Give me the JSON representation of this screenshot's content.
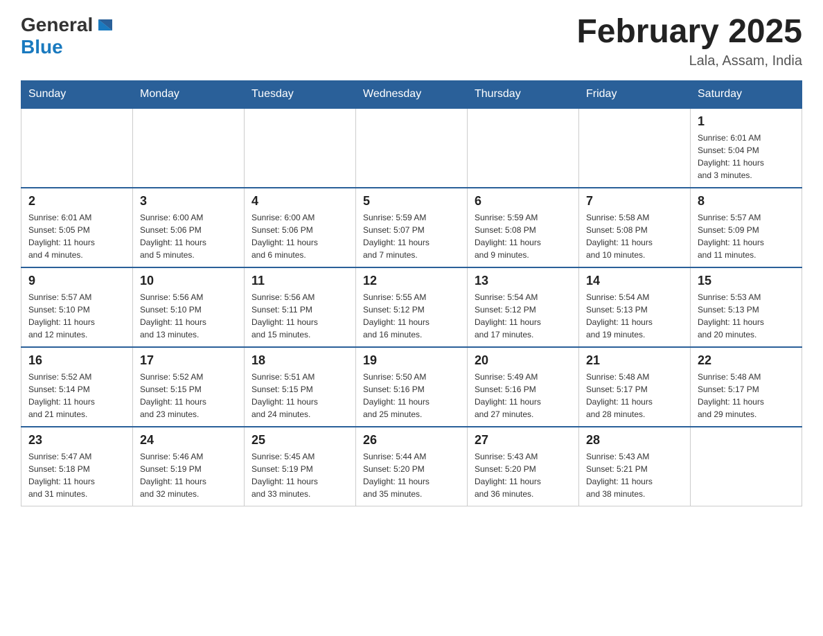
{
  "header": {
    "logo_general": "General",
    "logo_blue": "Blue",
    "month_title": "February 2025",
    "location": "Lala, Assam, India"
  },
  "weekdays": [
    "Sunday",
    "Monday",
    "Tuesday",
    "Wednesday",
    "Thursday",
    "Friday",
    "Saturday"
  ],
  "weeks": [
    [
      {
        "day": "",
        "info": ""
      },
      {
        "day": "",
        "info": ""
      },
      {
        "day": "",
        "info": ""
      },
      {
        "day": "",
        "info": ""
      },
      {
        "day": "",
        "info": ""
      },
      {
        "day": "",
        "info": ""
      },
      {
        "day": "1",
        "info": "Sunrise: 6:01 AM\nSunset: 5:04 PM\nDaylight: 11 hours\nand 3 minutes."
      }
    ],
    [
      {
        "day": "2",
        "info": "Sunrise: 6:01 AM\nSunset: 5:05 PM\nDaylight: 11 hours\nand 4 minutes."
      },
      {
        "day": "3",
        "info": "Sunrise: 6:00 AM\nSunset: 5:06 PM\nDaylight: 11 hours\nand 5 minutes."
      },
      {
        "day": "4",
        "info": "Sunrise: 6:00 AM\nSunset: 5:06 PM\nDaylight: 11 hours\nand 6 minutes."
      },
      {
        "day": "5",
        "info": "Sunrise: 5:59 AM\nSunset: 5:07 PM\nDaylight: 11 hours\nand 7 minutes."
      },
      {
        "day": "6",
        "info": "Sunrise: 5:59 AM\nSunset: 5:08 PM\nDaylight: 11 hours\nand 9 minutes."
      },
      {
        "day": "7",
        "info": "Sunrise: 5:58 AM\nSunset: 5:08 PM\nDaylight: 11 hours\nand 10 minutes."
      },
      {
        "day": "8",
        "info": "Sunrise: 5:57 AM\nSunset: 5:09 PM\nDaylight: 11 hours\nand 11 minutes."
      }
    ],
    [
      {
        "day": "9",
        "info": "Sunrise: 5:57 AM\nSunset: 5:10 PM\nDaylight: 11 hours\nand 12 minutes."
      },
      {
        "day": "10",
        "info": "Sunrise: 5:56 AM\nSunset: 5:10 PM\nDaylight: 11 hours\nand 13 minutes."
      },
      {
        "day": "11",
        "info": "Sunrise: 5:56 AM\nSunset: 5:11 PM\nDaylight: 11 hours\nand 15 minutes."
      },
      {
        "day": "12",
        "info": "Sunrise: 5:55 AM\nSunset: 5:12 PM\nDaylight: 11 hours\nand 16 minutes."
      },
      {
        "day": "13",
        "info": "Sunrise: 5:54 AM\nSunset: 5:12 PM\nDaylight: 11 hours\nand 17 minutes."
      },
      {
        "day": "14",
        "info": "Sunrise: 5:54 AM\nSunset: 5:13 PM\nDaylight: 11 hours\nand 19 minutes."
      },
      {
        "day": "15",
        "info": "Sunrise: 5:53 AM\nSunset: 5:13 PM\nDaylight: 11 hours\nand 20 minutes."
      }
    ],
    [
      {
        "day": "16",
        "info": "Sunrise: 5:52 AM\nSunset: 5:14 PM\nDaylight: 11 hours\nand 21 minutes."
      },
      {
        "day": "17",
        "info": "Sunrise: 5:52 AM\nSunset: 5:15 PM\nDaylight: 11 hours\nand 23 minutes."
      },
      {
        "day": "18",
        "info": "Sunrise: 5:51 AM\nSunset: 5:15 PM\nDaylight: 11 hours\nand 24 minutes."
      },
      {
        "day": "19",
        "info": "Sunrise: 5:50 AM\nSunset: 5:16 PM\nDaylight: 11 hours\nand 25 minutes."
      },
      {
        "day": "20",
        "info": "Sunrise: 5:49 AM\nSunset: 5:16 PM\nDaylight: 11 hours\nand 27 minutes."
      },
      {
        "day": "21",
        "info": "Sunrise: 5:48 AM\nSunset: 5:17 PM\nDaylight: 11 hours\nand 28 minutes."
      },
      {
        "day": "22",
        "info": "Sunrise: 5:48 AM\nSunset: 5:17 PM\nDaylight: 11 hours\nand 29 minutes."
      }
    ],
    [
      {
        "day": "23",
        "info": "Sunrise: 5:47 AM\nSunset: 5:18 PM\nDaylight: 11 hours\nand 31 minutes."
      },
      {
        "day": "24",
        "info": "Sunrise: 5:46 AM\nSunset: 5:19 PM\nDaylight: 11 hours\nand 32 minutes."
      },
      {
        "day": "25",
        "info": "Sunrise: 5:45 AM\nSunset: 5:19 PM\nDaylight: 11 hours\nand 33 minutes."
      },
      {
        "day": "26",
        "info": "Sunrise: 5:44 AM\nSunset: 5:20 PM\nDaylight: 11 hours\nand 35 minutes."
      },
      {
        "day": "27",
        "info": "Sunrise: 5:43 AM\nSunset: 5:20 PM\nDaylight: 11 hours\nand 36 minutes."
      },
      {
        "day": "28",
        "info": "Sunrise: 5:43 AM\nSunset: 5:21 PM\nDaylight: 11 hours\nand 38 minutes."
      },
      {
        "day": "",
        "info": ""
      }
    ]
  ]
}
